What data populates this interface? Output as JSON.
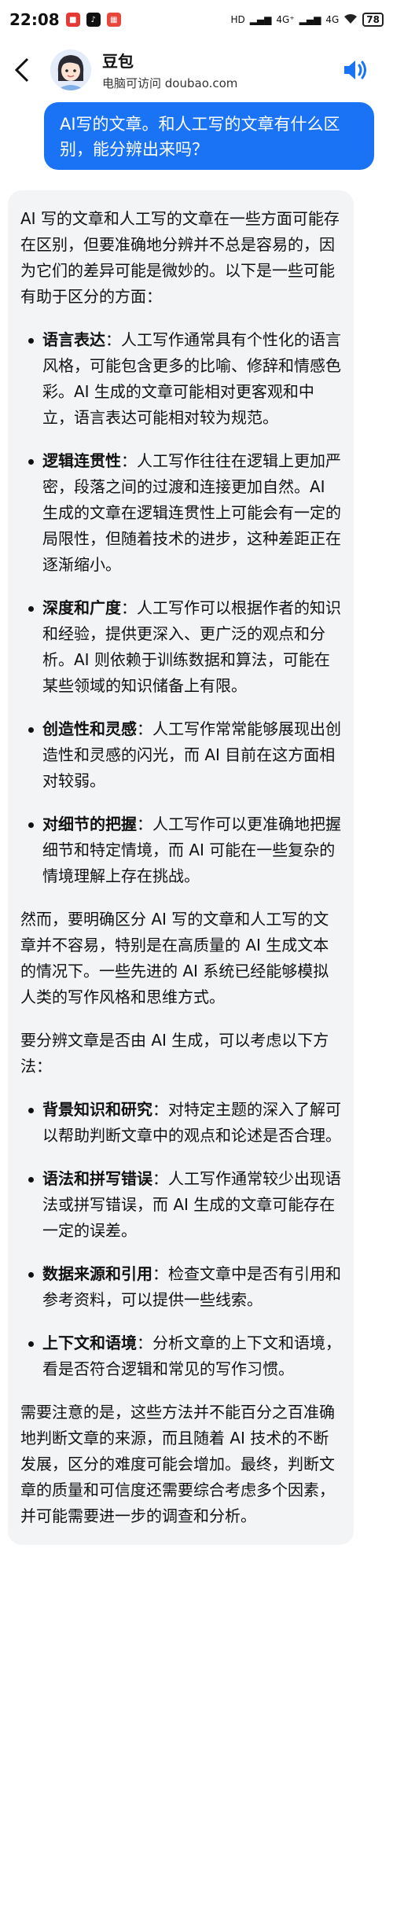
{
  "status_bar": {
    "time": "22:08",
    "signal_1": "4G⁺",
    "signal_2": "4G",
    "battery": "78",
    "hd_label": "HD"
  },
  "header": {
    "bot_name": "豆包",
    "bot_subtitle": "电脑可访问 doubao.com"
  },
  "user_message": "AI写的文章。和人工写的文章有什么区别，能分辨出来吗？",
  "reply": {
    "intro": "AI 写的文章和人工写的文章在一些方面可能存在区别，但要准确地分辨并不总是容易的，因为它们的差异可能是微妙的。以下是一些可能有助于区分的方面：",
    "aspects": [
      {
        "title": "语言表达",
        "text": "：人工写作通常具有个性化的语言风格，可能包含更多的比喻、修辞和情感色彩。AI 生成的文章可能相对更客观和中立，语言表达可能相对较为规范。"
      },
      {
        "title": "逻辑连贯性",
        "text": "：人工写作往往在逻辑上更加严密，段落之间的过渡和连接更加自然。AI 生成的文章在逻辑连贯性上可能会有一定的局限性，但随着技术的进步，这种差距正在逐渐缩小。"
      },
      {
        "title": "深度和广度",
        "text": "：人工写作可以根据作者的知识和经验，提供更深入、更广泛的观点和分析。AI 则依赖于训练数据和算法，可能在某些领域的知识储备上有限。"
      },
      {
        "title": "创造性和灵感",
        "text": "：人工写作常常能够展现出创造性和灵感的闪光，而 AI 目前在这方面相对较弱。"
      },
      {
        "title": "对细节的把握",
        "text": "：人工写作可以更准确地把握细节和特定情境，而 AI 可能在一些复杂的情境理解上存在挑战。"
      }
    ],
    "middle": "然而，要明确区分 AI 写的文章和人工写的文章并不容易，特别是在高质量的 AI 生成文本的情况下。一些先进的 AI 系统已经能够模拟人类的写作风格和思维方式。",
    "methods_intro": "要分辨文章是否由 AI 生成，可以考虑以下方法：",
    "methods": [
      {
        "title": "背景知识和研究",
        "text": "：对特定主题的深入了解可以帮助判断文章中的观点和论述是否合理。"
      },
      {
        "title": "语法和拼写错误",
        "text": "：人工写作通常较少出现语法或拼写错误，而 AI 生成的文章可能存在一定的误差。"
      },
      {
        "title": "数据来源和引用",
        "text": "：检查文章中是否有引用和参考资料，可以提供一些线索。"
      },
      {
        "title": "上下文和语境",
        "text": "：分析文章的上下文和语境，看是否符合逻辑和常见的写作习惯。"
      }
    ],
    "conclusion": "需要注意的是，这些方法并不能百分之百准确地判断文章的来源，而且随着 AI 技术的不断发展，区分的难度可能会增加。最终，判断文章的质量和可信度还需要综合考虑多个因素，并可能需要进一步的调查和分析。"
  },
  "colors": {
    "user_bubble": "#1a73f5",
    "reply_bubble": "#f3f4f6",
    "accent": "#1a73f5"
  },
  "icons": [
    "back-arrow-icon",
    "bot-avatar-icon",
    "speaker-icon"
  ]
}
